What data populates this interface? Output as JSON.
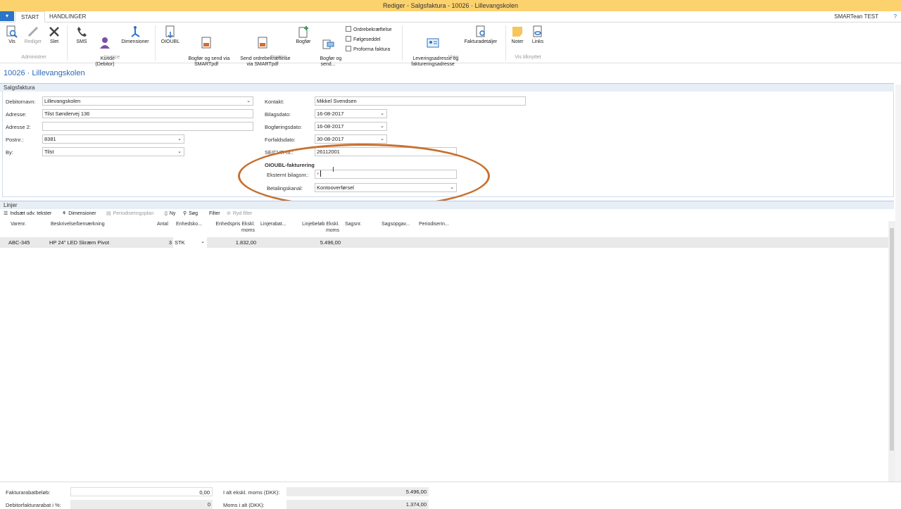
{
  "window": {
    "title": "Rediger - Salgsfaktura - 10026 · Lillevangskolen",
    "company": "SMARTean TEST",
    "help": "?"
  },
  "tabs": {
    "app_menu": "▾",
    "start": "START",
    "handlinger": "HANDLINGER"
  },
  "ribbon": {
    "vis": "Vis",
    "rediger": "Rediger",
    "slet": "Slet",
    "grp_admin": "Administrer",
    "sms": "SMS",
    "kunde": "Kunde\n(Debitor)",
    "dimensioner": "Dimensioner",
    "grp_invoice": "Invoice",
    "oioubl": "OIOUBL",
    "bogfor_send_smart": "Bogfør og send via\nSMARTpdf",
    "send_ordre": "Send ordrebekræftelse\nvia SMARTpdf",
    "bogfor": "Bogfør",
    "bogfor_send": "Bogfør og\nsend...",
    "ordrebekraeftelse": "Ordrebekræftelse",
    "folgeseddel": "Følgeseddel",
    "proforma": "Proforma faktura",
    "grp_posting": "Posting",
    "levering": "Leveringsadresse og\nfaktureringsadresse",
    "fakturadetaljer": "Fakturadetaljer",
    "grp_view": "View",
    "noter": "Noter",
    "links": "Links",
    "grp_vis": "Vis tilknyttet"
  },
  "page_title": "10026 · Lillevangskolen",
  "section_salgsfaktura": "Salgsfaktura",
  "form": {
    "debitornavn_label": "Debitornavn:",
    "debitornavn": "Lillevangskolen",
    "adresse_label": "Adresse:",
    "adresse": "Tilst Søndervej 136",
    "adresse2_label": "Adresse 2:",
    "adresse2": "",
    "postnr_label": "Postnr.:",
    "postnr": "8381",
    "by_label": "By:",
    "by": "Tilst",
    "kontakt_label": "Kontakt:",
    "kontakt": "Mikkel Svendsen",
    "bilagsdato_label": "Bilagsdato:",
    "bilagsdato": "16-08-2017",
    "bogforingsdato_label": "Bogføringsdato:",
    "bogforingsdato": "16-08-2017",
    "forfaldsdato_label": "Forfaldsdato:",
    "forfaldsdato": "30-08-2017",
    "secvr_label": "SE/CVR-nr.:",
    "secvr": "26112001",
    "oioubl_heading": "OIOUBL-fakturering",
    "eksternt_label": "Eksternt bilagsnr.:",
    "eksternt": "",
    "required_mark": "*",
    "betalingskanal_label": "Betalingskanal:",
    "betalingskanal": "Kontooverførsel"
  },
  "section_linjer": "Linjer",
  "lines_toolbar": {
    "indsaet": "Indsæt udv. tekster",
    "dimensioner": "Dimensioner",
    "periodisering": "Periodiseringsplan",
    "ny": "Ny",
    "sog": "Søg",
    "filter": "Filter",
    "ryd": "Ryd filter"
  },
  "lines_headers": [
    "Varenr.",
    "Beskrivelse/bemærkning",
    "Antal",
    "Enhedsko...",
    "Enhedspris Ekskl.\nmoms",
    "Linjerabat...",
    "Linjebeløb Ekskl.\nmoms",
    "Sagsnr.",
    "Sagsopgav...",
    "Periodiserin..."
  ],
  "lines": [
    {
      "varenr": "ABC-345",
      "beskrivelse": "HP 24\" LED Skræm Pivot",
      "antal": "3",
      "enhed": "STK",
      "enhedspris": "1.832,00",
      "linjebelob": "5.496,00"
    }
  ],
  "footer": {
    "fakturarabat_label": "Fakturarabatbeløb:",
    "fakturarabat": "0,00",
    "debitorrabat_label": "Debitorfakturarabat i %:",
    "debitorrabat": "0",
    "ialt_label": "I alt ekskl. moms (DKK):",
    "ialt": "5.496,00",
    "moms_label": "Moms i alt (DKK):",
    "moms": "1.374,00"
  }
}
